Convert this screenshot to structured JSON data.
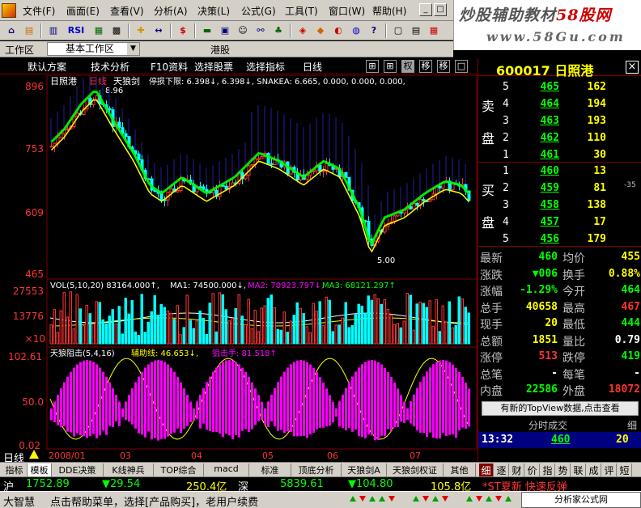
{
  "menubar": {
    "items": [
      "文件(F)",
      "画面(E)",
      "查看(V)",
      "分析(A)",
      "决策(L)",
      "公式(G)",
      "工具(T)",
      "窗口(W)",
      "帮助(H)"
    ]
  },
  "brand": {
    "line1_a": "炒股辅助教材",
    "line1_b": "58股网",
    "line2": "www.58Gu.com"
  },
  "toolbar": {
    "rsi_label": "RSI",
    "s_label": "$"
  },
  "workbar": {
    "label": "工作区",
    "selected": "基本工作区",
    "port": "港股"
  },
  "chartbar": {
    "items": [
      "默认方案",
      "技术分析",
      "F10资料",
      "选择股票",
      "选择指标",
      "日线"
    ],
    "boxes": [
      "⊞",
      "⊞",
      "权",
      "移",
      "移",
      "□"
    ]
  },
  "stock": {
    "code": "600017",
    "name": "日照港",
    "period": "日线",
    "close_label": "×"
  },
  "price_panel": {
    "title": "日照港",
    "indicator_title": "天狼剑",
    "legend_text": "停损下限: 6.398↓, 6.398↓, SNAKEA: 6.665, 0.000, 0.000, 0.000,",
    "high_label": "8.96",
    "low_label": "5.00",
    "axis": [
      "896",
      "753",
      "609",
      "465"
    ]
  },
  "volume_panel": {
    "legend_vol": "VOL(5,10,20) 83164.000↑,",
    "legend_ma1": "MA1: 74500.000↓,",
    "legend_ma2": "MA2: 70923.797↓,",
    "legend_ma3": "MA3: 68121.297↑",
    "axis": [
      "27553",
      "13776",
      "×10"
    ]
  },
  "osc_panel": {
    "legend_name": "天狼阻击(5,4,16)",
    "legend_aux": "辅助线: 46.653↓,",
    "legend_snipe": "狙击手: 81.518↑",
    "axis": [
      "102.61",
      "50.0",
      "0.02"
    ]
  },
  "xaxis": {
    "labels": [
      "2008/01",
      "03",
      "04",
      "05",
      "06",
      "07"
    ]
  },
  "orderbook": {
    "sell_label": [
      "卖",
      "盘"
    ],
    "buy_label": [
      "买",
      "盘"
    ],
    "asks": [
      {
        "level": "5",
        "price": "465",
        "vol": "162"
      },
      {
        "level": "4",
        "price": "464",
        "vol": "194"
      },
      {
        "level": "3",
        "price": "463",
        "vol": "193"
      },
      {
        "level": "2",
        "price": "462",
        "vol": "110"
      },
      {
        "level": "1",
        "price": "461",
        "vol": "30"
      }
    ],
    "bids": [
      {
        "level": "1",
        "price": "460",
        "vol": "13"
      },
      {
        "level": "2",
        "price": "459",
        "vol": "81"
      },
      {
        "level": "3",
        "price": "458",
        "vol": "138"
      },
      {
        "level": "4",
        "price": "457",
        "vol": "17"
      },
      {
        "level": "5",
        "price": "456",
        "vol": "179"
      }
    ],
    "bid_extra": "-35"
  },
  "stats": [
    {
      "k1": "最新",
      "v1": "460",
      "c1": "#00ff00",
      "k2": "均价",
      "v2": "455",
      "c2": "#ffff00"
    },
    {
      "k1": "涨跌",
      "v1": "▼006",
      "c1": "#00ff00",
      "k2": "换手",
      "v2": "0.88%",
      "c2": "#ffff00"
    },
    {
      "k1": "涨幅",
      "v1": "-1.29%",
      "c1": "#00ff00",
      "k2": "今开",
      "v2": "464",
      "c2": "#00ff00"
    },
    {
      "k1": "总手",
      "v1": "40658",
      "c1": "#ffff00",
      "k2": "最高",
      "v2": "467",
      "c2": "#ff3333"
    },
    {
      "k1": "现手",
      "v1": "20",
      "c1": "#ffff00",
      "k2": "最低",
      "v2": "444",
      "c2": "#00ff00"
    },
    {
      "k1": "总额",
      "v1": "1851",
      "c1": "#ffff00",
      "k2": "量比",
      "v2": "0.79",
      "c2": "#ffffff"
    },
    {
      "k1": "涨停",
      "v1": "513",
      "c1": "#ff3333",
      "k2": "跌停",
      "v2": "419",
      "c2": "#00ff00"
    },
    {
      "k1": "总笔",
      "v1": "-",
      "c1": "#ffffff",
      "k2": "每笔",
      "v2": "-",
      "c2": "#ffffff"
    },
    {
      "k1": "内盘",
      "v1": "22586",
      "c1": "#00ff00",
      "k2": "外盘",
      "v2": "18072",
      "c2": "#ff3333"
    }
  ],
  "notice": "有新的TopView数据,点击查看",
  "ticks": {
    "header": "分时成交",
    "header_extra": "细",
    "time": "13:32",
    "price": "460",
    "vol": "20"
  },
  "bottomtabs": {
    "left": [
      "指标",
      "模板",
      "DDE决策",
      "K线神兵",
      "TOP综合",
      "macd",
      "标准",
      "顶底分析",
      "天狼剑A",
      "天狼剑权证",
      "其他"
    ],
    "right": [
      "细",
      "逐",
      "财",
      "价",
      "指",
      "势",
      "联",
      "成",
      "评",
      "短"
    ]
  },
  "market": {
    "sh_label": "沪",
    "sh_index": "1752.89",
    "sh_change": "▼29.54",
    "sh_amount": "250.4亿",
    "sz_label": "深",
    "sz_index": "5839.61",
    "sz_change": "▼104.80",
    "sz_amount": "105.8亿",
    "news": "*ST夏新 快速反弹"
  },
  "status": {
    "left": "大智慧",
    "hint": "点击帮助菜单，选择[产品购买]，老用户续费",
    "watermark": "分析家公式网 www.88gs.com"
  },
  "colors": {
    "up": "#ff3333",
    "down": "#00ffff",
    "green": "#00ff00",
    "yellow": "#ffff00",
    "magenta": "#ff00ff",
    "grid": "#800000"
  }
}
